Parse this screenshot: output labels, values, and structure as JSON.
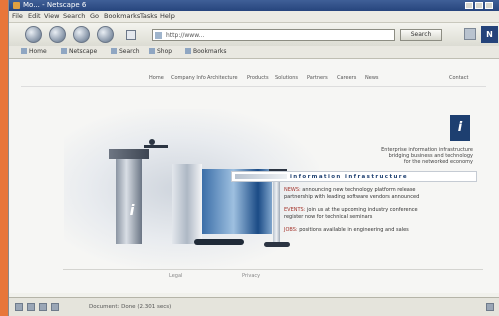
{
  "window": {
    "title": "Mo... - Netscape 6"
  },
  "menu": [
    "File",
    "Edit",
    "View",
    "Search",
    "Go",
    "Bookmarks",
    "Tasks",
    "Help"
  ],
  "nav": {
    "url_placeholder": "http://www...",
    "search_label": "Search",
    "throbber_letter": "N"
  },
  "bookmarks": [
    "Home",
    "Netscape",
    "Search",
    "Shop",
    "Bookmarks"
  ],
  "site_nav": [
    "Home",
    "Company Info",
    "Architecture",
    "Products",
    "Solutions",
    "Partners",
    "Careers",
    "News",
    "Contact"
  ],
  "hero": {
    "logo_letter": "i"
  },
  "brand": {
    "letter": "i"
  },
  "tagline": [
    "Enterprise information infrastructure",
    "bridging business and technology",
    "for the networked economy"
  ],
  "spaced_banner": "information infrastructure",
  "news": [
    {
      "lead": "NEWS:",
      "text": "announcing new technology platform release"
    },
    {
      "lead": "",
      "text": "partnership with leading software vendors announced"
    },
    {
      "lead": "EVENTS:",
      "text": "join us at the upcoming industry conference"
    },
    {
      "lead": "",
      "text": "register now for technical seminars"
    },
    {
      "lead": "JOBS:",
      "text": "positions available in engineering and sales"
    }
  ],
  "bottom_links": [
    "Legal",
    "Privacy"
  ],
  "status": {
    "text": "Document: Done (2.301 secs)"
  },
  "colors": {
    "accent": "#1d3f70",
    "window_frame": "#e8763a",
    "news_lead": "#a3332b"
  }
}
